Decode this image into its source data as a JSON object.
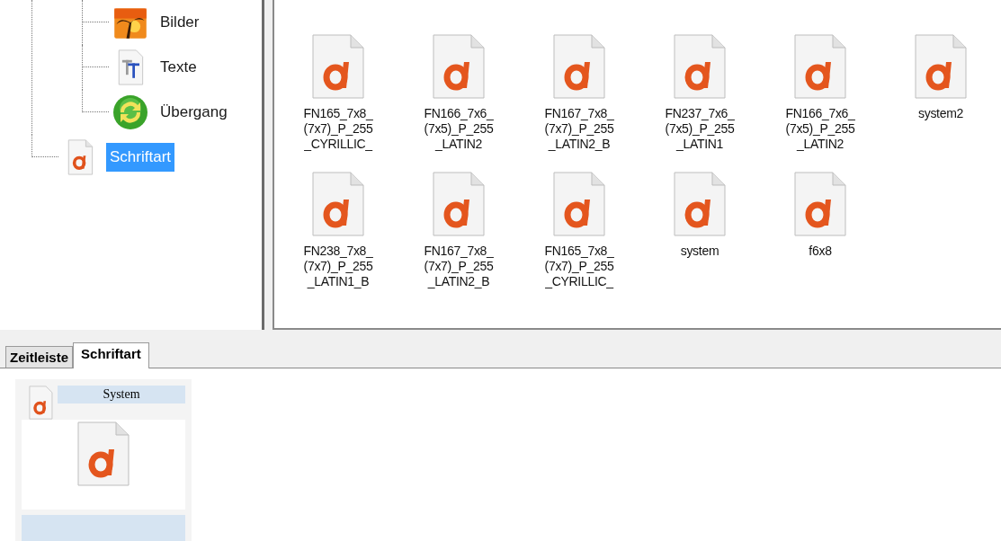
{
  "tree": [
    {
      "children": [
        {
          "label": "Bilder",
          "kind": "image",
          "selected": false
        },
        {
          "label": "Texte",
          "kind": "text",
          "selected": false
        },
        {
          "label": "Übergang",
          "kind": "transition",
          "selected": false
        }
      ]
    },
    {
      "label": "Schriftart",
      "kind": "font",
      "selected": true
    }
  ],
  "files": [
    {
      "name": "FN165_7x8_(7x7)_P_255_CYRILLIC_"
    },
    {
      "name": "FN166_7x6_(7x5)_P_255_LATIN2"
    },
    {
      "name": "FN167_7x8_(7x7)_P_255_LATIN2_B"
    },
    {
      "name": "FN237_7x6_(7x5)_P_255_LATIN1"
    },
    {
      "name": "FN166_7x6_(7x5)_P_255_LATIN2"
    },
    {
      "name": "system2"
    },
    {
      "name": "FN238_7x8_(7x7)_P_255_LATIN1_B"
    },
    {
      "name": "FN167_7x8_(7x7)_P_255_LATIN2_B"
    },
    {
      "name": "FN165_7x8_(7x7)_P_255_CYRILLIC_"
    },
    {
      "name": "system"
    },
    {
      "name": "f6x8"
    }
  ],
  "tabs": [
    {
      "label": "Zeitleiste",
      "selected": false
    },
    {
      "label": "Schriftart",
      "selected": true
    }
  ],
  "font_preview": {
    "title": "System"
  }
}
